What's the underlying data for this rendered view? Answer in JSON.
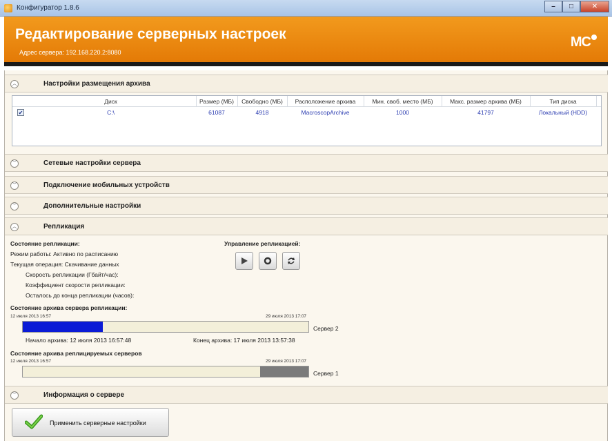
{
  "window": {
    "title": "Конфигуратор 1.8.6",
    "minimize": "–",
    "maximize": "□",
    "close": "✕"
  },
  "header": {
    "title": "Редактирование серверных настроек",
    "subtitle": "Адрес сервера: 192.168.220.2:8080",
    "logo_text": "MC"
  },
  "sections": {
    "archive": "Настройки размещения архива",
    "network": "Сетевые настройки сервера",
    "mobile": "Подключение мобильных устройств",
    "additional": "Дополнительные настройки",
    "replication": "Репликация",
    "server_info": "Информация о сервере"
  },
  "table": {
    "columns": [
      "Диск",
      "Размер (МБ)",
      "Свободно (МБ)",
      "Расположение архива",
      "Мин. своб. место (МБ)",
      "Макс. размер архива (МБ)",
      "Тип диска"
    ],
    "rows": [
      {
        "checked": true,
        "disk": "C:\\",
        "size": "61087",
        "free": "4918",
        "location": "MacroscopArchive",
        "min_free": "1000",
        "max_size": "41797",
        "type": "Локальный (HDD)"
      }
    ]
  },
  "replication": {
    "state_title": "Состояние репликации:",
    "mode": "Режим работы:  Активно по расписанию",
    "operation": "Текущая операция:  Скачивание данных",
    "speed": "Скорость репликации (Гбайт/час):",
    "coefficient": "Коэффициент скорости репликации:",
    "remaining": "Осталось до конца репликации (часов):",
    "control_title": "Управление репликацией:",
    "archive_state_title": "Состояние архива сервера репликации:",
    "bar1": {
      "start": "12 июля 2013 16:57",
      "end": "29 июля 2013 17:07",
      "server": "Сервер 2",
      "fill_fraction": 0.28,
      "fill_color": "#0b1bd6"
    },
    "archive_start": "Начало архива:  12 июля 2013 16:57:48",
    "archive_end": "Конец архива:  17 июля 2013 13:57:38",
    "replicated_title": "Состояние архива реплицируемых серверов",
    "bar2": {
      "start": "12 июля 2013 16:57",
      "end": "29 июля 2013 17:07",
      "server": "Сервер 1",
      "fill_fraction_start": 0.83,
      "fill_color": "#7b7b7b"
    }
  },
  "apply_button": "Применить серверные настройки"
}
